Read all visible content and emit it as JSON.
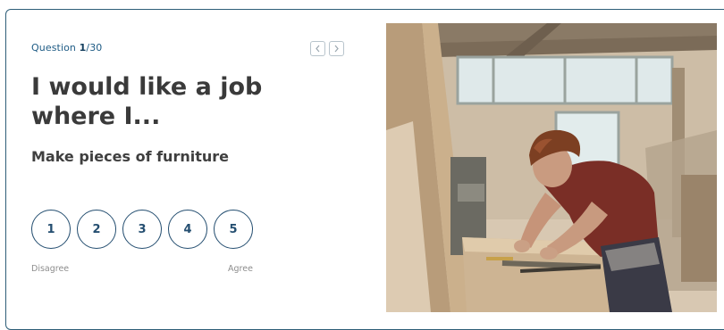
{
  "question": {
    "prefix": "Question",
    "current": "1",
    "separator": "/",
    "total": "30"
  },
  "navigation": {
    "prev_icon": "chevron-left-icon",
    "next_icon": "chevron-right-icon"
  },
  "prompt": {
    "title": "I would like a job where I...",
    "statement": "Make pieces of furniture"
  },
  "rating": {
    "options": [
      "1",
      "2",
      "3",
      "4",
      "5"
    ],
    "low_label": "Disagree",
    "high_label": "Agree"
  },
  "colors": {
    "accent": "#244e70",
    "border": "#2e5e78",
    "title_text": "#3a3a3a",
    "muted_text": "#8d8d8d"
  }
}
